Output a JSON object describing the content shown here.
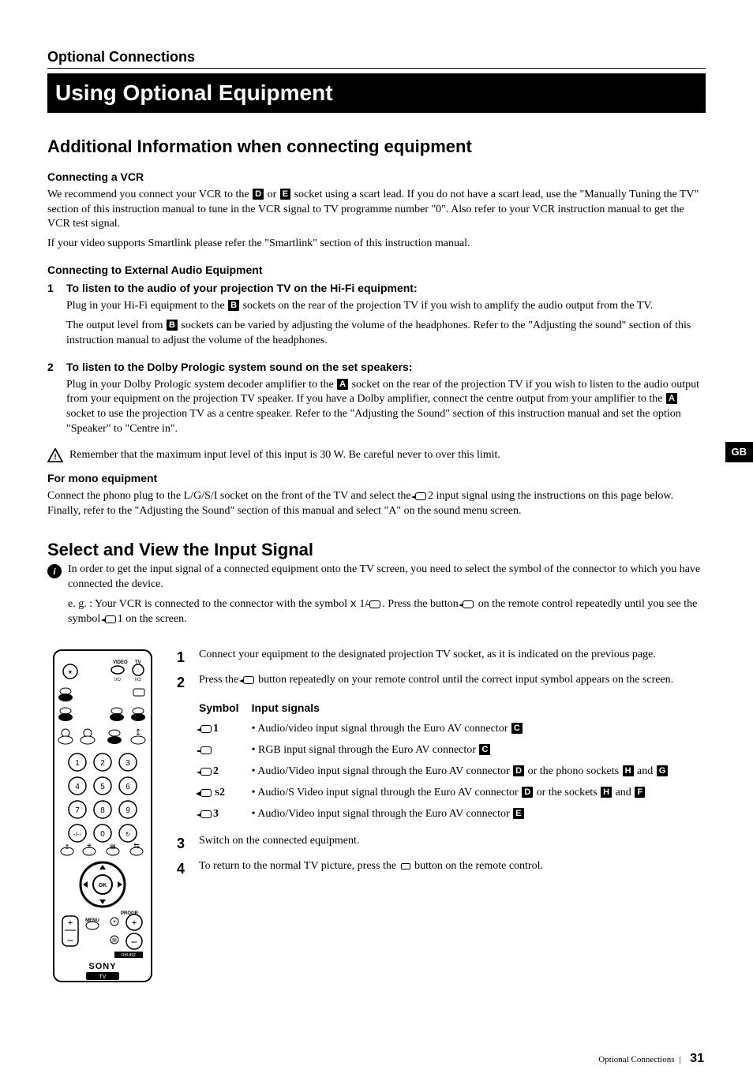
{
  "header": {
    "label": "Optional Connections",
    "banner": "Using Optional Equipment"
  },
  "side_tab": "GB",
  "sect1": {
    "title": "Additional Information when connecting equipment",
    "sub1": {
      "heading": "Connecting a VCR",
      "p1_a": "We recommend you connect your VCR to the ",
      "p1_b": " or ",
      "p1_c": " socket using a scart lead. If you do not have a scart lead, use the \"Manually Tuning the TV\" section of this instruction manual to tune in the VCR signal to TV programme number \"0\". Also refer to your VCR instruction manual to get the VCR test signal.",
      "p2": "If your video supports Smartlink please refer the \"Smartlink\" section of this instruction manual."
    },
    "sub2": {
      "heading": "Connecting to External Audio Equipment",
      "item1": {
        "title": "To listen to the audio of your projection TV on the Hi-Fi equipment:",
        "p1_a": "Plug in your Hi-Fi equipment to the ",
        "p1_b": " sockets on the rear of the projection TV if you wish to amplify the audio output from the TV.",
        "p2_a": "The output level from ",
        "p2_b": " sockets can be varied by adjusting the volume of the headphones. Refer to the \"Adjusting the sound\" section of this instruction manual to adjust the volume of the headphones."
      },
      "item2": {
        "title": "To listen to the Dolby Prologic system sound on the set speakers:",
        "p1_a": "Plug in your Dolby Prologic system decoder amplifier to the ",
        "p1_b": " socket on the rear of the projection TV if you wish to listen to the audio output from your equipment on the projection TV speaker. If you have a Dolby amplifier, connect the centre output from your amplifier to the ",
        "p1_c": " socket to use the projection TV as a centre speaker. Refer to the \"Adjusting the Sound\" section of this instruction manual and set the option \"Speaker\" to \"Centre in\"."
      },
      "warn": "Remember that the maximum input level of this input is 30 W. Be careful never to over this limit."
    },
    "sub3": {
      "heading": "For mono equipment",
      "p1_a": "Connect the phono plug to the L/G/S/I socket on the front of the TV and select the  ",
      "p1_b": "2 input signal using the instructions on this page below. Finally, refer to the \"Adjusting the Sound\" section of this manual and select \"A\" on the sound menu screen."
    }
  },
  "sect2": {
    "title": "Select and View the Input Signal",
    "info_p1": "In order to get the input signal of a connected equipment onto the TV screen, you need to select the symbol of the connector to which you have connected the device.",
    "info_p2_a": "e. g. : Your VCR is connected to the connector with the symbol ",
    "info_p2_b": "   1/",
    "info_p2_c": ". Press the button  ",
    "info_p2_d": " on the remote control repeatedly until you see the symbol ",
    "info_p2_e": "1 on the screen.",
    "steps": {
      "s1": "Connect your equipment to the designated projection TV socket, as it is indicated on the previous page.",
      "s2_a": "Press the ",
      "s2_b": " button repeatedly on your remote control until the correct input symbol appears on the screen.",
      "s3": "Switch on the connected equipment.",
      "s4_a": "To return to the normal TV picture, press the  ",
      "s4_b": " button on the remote control."
    },
    "table": {
      "hdr_sym": "Symbol",
      "hdr_sig": "Input signals",
      "rows": [
        {
          "sym_suffix": "1",
          "sym_type": "av",
          "parts": [
            "Audio/video input signal through the Euro AV connector "
          ],
          "boxes": [
            "C"
          ]
        },
        {
          "sym_suffix": "",
          "sym_type": "rgb",
          "parts": [
            "RGB input signal through the Euro AV connector "
          ],
          "boxes": [
            "C"
          ]
        },
        {
          "sym_suffix": "2",
          "sym_type": "av",
          "parts": [
            "Audio/Video input signal through the Euro AV connector ",
            " or the phono sockets ",
            " and "
          ],
          "boxes": [
            "D",
            "H",
            "G"
          ]
        },
        {
          "sym_suffix": "2",
          "sym_type": "sv",
          "parts": [
            "Audio/S Video input signal through the Euro AV connector ",
            " or the  sockets ",
            " and "
          ],
          "boxes": [
            "D",
            "H",
            "F"
          ]
        },
        {
          "sym_suffix": "3",
          "sym_type": "av",
          "parts": [
            "Audio/Video input signal through the Euro AV connector "
          ],
          "boxes": [
            "E"
          ]
        }
      ]
    }
  },
  "letters": {
    "A": "A",
    "B": "B",
    "C": "C",
    "D": "D",
    "E": "E",
    "F": "F",
    "G": "G",
    "H": "H"
  },
  "footer": {
    "label": "Optional Connections",
    "page": "31"
  },
  "remote": {
    "brand": "SONY",
    "tv_label": "TV",
    "model": "RM-892",
    "video_lbl": "VIDEO",
    "tv_lbl": "TV",
    "io1": "I/⏻",
    "io2": "I/⏻",
    "progr": "PROGR",
    "plus": "+",
    "minus": "–",
    "ok": "OK",
    "keys": [
      "1",
      "2",
      "3",
      "4",
      "5",
      "6",
      "7",
      "8",
      "9",
      "0"
    ]
  }
}
